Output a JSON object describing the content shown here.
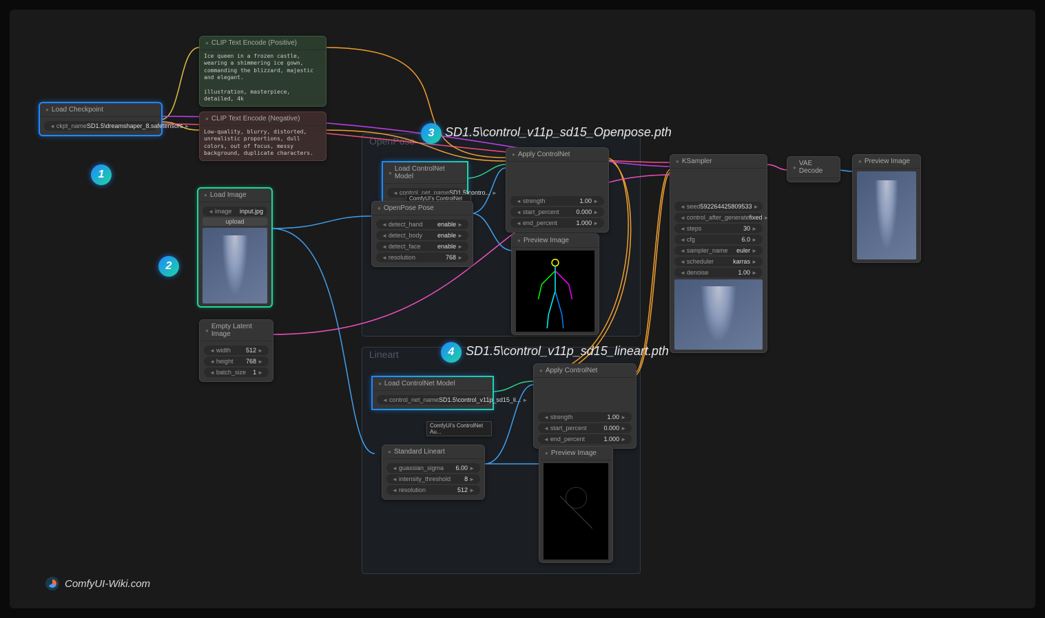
{
  "credit": "ComfyUI-Wiki.com",
  "annotations": {
    "a3": "SD1.5\\control_v11p_sd15_Openpose.pth",
    "a4": "SD1.5\\control_v11p_sd15_lineart.pth"
  },
  "badges": {
    "b1": "1",
    "b2": "2",
    "b3": "3",
    "b4": "4"
  },
  "groups": {
    "openpose": "OpenPose",
    "lineart": "Lineart"
  },
  "nodes": {
    "load_checkpoint": {
      "title": "Load Checkpoint",
      "widget_label": "ckpt_name",
      "widget_value": "SD1.5\\dreamshaper_8.safetensors"
    },
    "clip_pos": {
      "title": "CLIP Text Encode (Positive)",
      "text": "Ice queen in a frozen castle, wearing a shimmering ice gown, commanding the blizzard, majestic and elegant.\n\nillustration, masterpiece, detailed, 4k"
    },
    "clip_neg": {
      "title": "CLIP Text Encode (Negative)",
      "text": "Low-quality, blurry, distorted, unrealistic proportions, dull colors, out of focus, messy background, duplicate characters."
    },
    "load_image": {
      "title": "Load Image",
      "widget_label": "image",
      "widget_value": "input.jpg",
      "upload": "upload"
    },
    "empty_latent": {
      "title": "Empty Latent Image",
      "w": [
        [
          "width",
          "512"
        ],
        [
          "height",
          "768"
        ],
        [
          "batch_size",
          "1"
        ]
      ]
    },
    "load_cn1": {
      "title": "Load ControlNet Model",
      "widget_label": "control_net_name",
      "widget_value": "SD1.5\\contro...",
      "subtitle": "ComfyUI's ControlNet Au..."
    },
    "openpose_pose": {
      "title": "OpenPose Pose",
      "w": [
        [
          "detect_hand",
          "enable"
        ],
        [
          "detect_body",
          "enable"
        ],
        [
          "detect_face",
          "enable"
        ],
        [
          "resolution",
          "768"
        ]
      ]
    },
    "apply_cn1": {
      "title": "Apply ControlNet",
      "w": [
        [
          "strength",
          "1.00"
        ],
        [
          "start_percent",
          "0.000"
        ],
        [
          "end_percent",
          "1.000"
        ]
      ]
    },
    "preview1": {
      "title": "Preview Image"
    },
    "load_cn2": {
      "title": "Load ControlNet Model",
      "widget_label": "control_net_name",
      "widget_value": "SD1.5\\control_v11p_sd15_li...",
      "subtitle": "ComfyUI's ControlNet Au..."
    },
    "standard_lineart": {
      "title": "Standard Lineart",
      "w": [
        [
          "guassian_sigma",
          "6.00"
        ],
        [
          "intensity_threshold",
          "8"
        ],
        [
          "resolution",
          "512"
        ]
      ]
    },
    "apply_cn2": {
      "title": "Apply ControlNet",
      "w": [
        [
          "strength",
          "1.00"
        ],
        [
          "start_percent",
          "0.000"
        ],
        [
          "end_percent",
          "1.000"
        ]
      ]
    },
    "preview2": {
      "title": "Preview Image"
    },
    "ksampler": {
      "title": "KSampler",
      "w": [
        [
          "seed",
          "592264425809533"
        ],
        [
          "control_after_generate",
          "fixed"
        ],
        [
          "steps",
          "30"
        ],
        [
          "cfg",
          "6.0"
        ],
        [
          "sampler_name",
          "euler"
        ],
        [
          "scheduler",
          "karras"
        ],
        [
          "denoise",
          "1.00"
        ]
      ]
    },
    "vae_decode": {
      "title": "VAE Decode"
    },
    "preview3": {
      "title": "Preview Image"
    }
  }
}
